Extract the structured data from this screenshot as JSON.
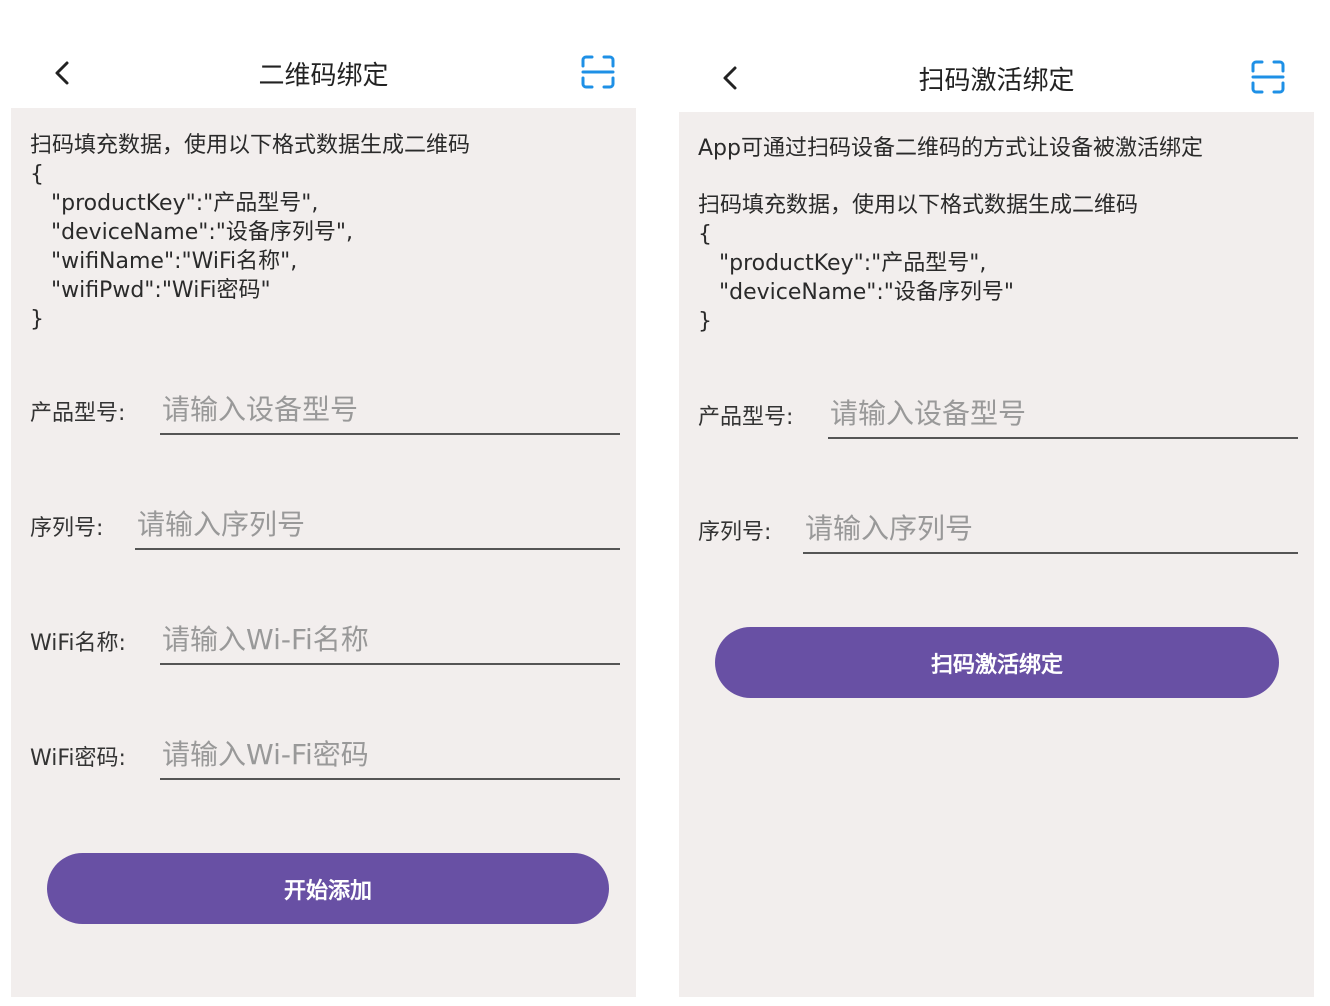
{
  "left_screen": {
    "title": "二维码绑定",
    "description": "扫码填充数据，使用以下格式数据生成二维码\n{\n   \"productKey\":\"产品型号\",\n   \"deviceName\":\"设备序列号\",\n   \"wifiName\":\"WiFi名称\",\n   \"wifiPwd\":\"WiFi密码\"\n}",
    "fields": [
      {
        "label": "产品型号:",
        "placeholder": "请输入设备型号"
      },
      {
        "label": "序列号:",
        "placeholder": "请输入序列号"
      },
      {
        "label": "WiFi名称:",
        "placeholder": "请输入Wi-Fi名称"
      },
      {
        "label": "WiFi密码:",
        "placeholder": "请输入Wi-Fi密码"
      }
    ],
    "button_label": "开始添加"
  },
  "right_screen": {
    "title": "扫码激活绑定",
    "intro": "App可通过扫码设备二维码的方式让设备被激活绑定",
    "description": "扫码填充数据，使用以下格式数据生成二维码\n{\n   \"productKey\":\"产品型号\",\n   \"deviceName\":\"设备序列号\"\n}",
    "fields": [
      {
        "label": "产品型号:",
        "placeholder": "请输入设备型号"
      },
      {
        "label": "序列号:",
        "placeholder": "请输入序列号"
      }
    ],
    "button_label": "扫码激活绑定"
  },
  "icons": {
    "back": "chevron-left-icon",
    "scan": "scan-icon"
  },
  "colors": {
    "accent": "#6850a4",
    "scan_icon": "#1e90e6",
    "background": "#f2eeed",
    "header": "#ffffff"
  }
}
